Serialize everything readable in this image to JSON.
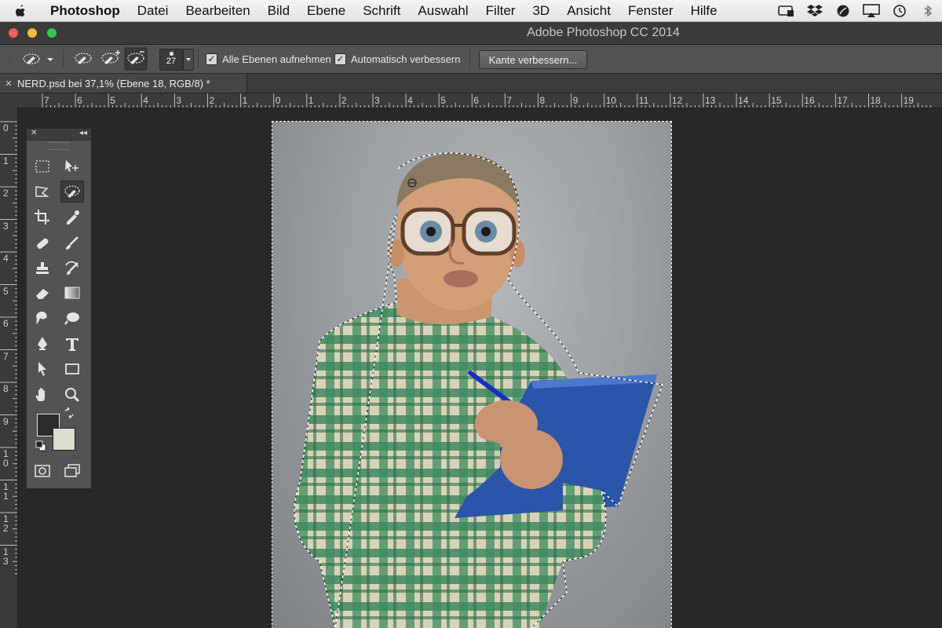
{
  "menubar": {
    "app_name": "Photoshop",
    "items": [
      "Datei",
      "Bearbeiten",
      "Bild",
      "Ebene",
      "Schrift",
      "Auswahl",
      "Filter",
      "3D",
      "Ansicht",
      "Fenster",
      "Hilfe"
    ],
    "tray_icons": [
      "display-battery-icon",
      "dropbox-icon",
      "leaf-icon",
      "airplay-icon",
      "time-machine-icon",
      "bluetooth-icon"
    ]
  },
  "window": {
    "title": "Adobe Photoshop CC 2014"
  },
  "options": {
    "brush_size": "27",
    "sample_all_layers_label": "Alle Ebenen aufnehmen",
    "sample_all_layers_checked": true,
    "auto_enhance_label": "Automatisch verbessern",
    "auto_enhance_checked": true,
    "refine_edge_label": "Kante verbessern..."
  },
  "document": {
    "tab_label": "NERD.psd bei 37,1% (Ebene 18, RGB/8) *"
  },
  "rulers": {
    "horizontal": [
      "7",
      "6",
      "5",
      "4",
      "3",
      "2",
      "1",
      "0",
      "1",
      "2",
      "3",
      "4",
      "5",
      "6",
      "7",
      "8",
      "9",
      "10",
      "11",
      "12",
      "13",
      "14",
      "15",
      "16",
      "17",
      "18",
      "19"
    ],
    "vertical": [
      "0",
      "1",
      "2",
      "3",
      "4",
      "5",
      "6",
      "7",
      "8",
      "9",
      "10",
      "11",
      "12",
      "13"
    ]
  },
  "colors": {
    "foreground": "#2b2b2b",
    "background": "#dcdcd0",
    "accent_selection": "#ffffff"
  }
}
